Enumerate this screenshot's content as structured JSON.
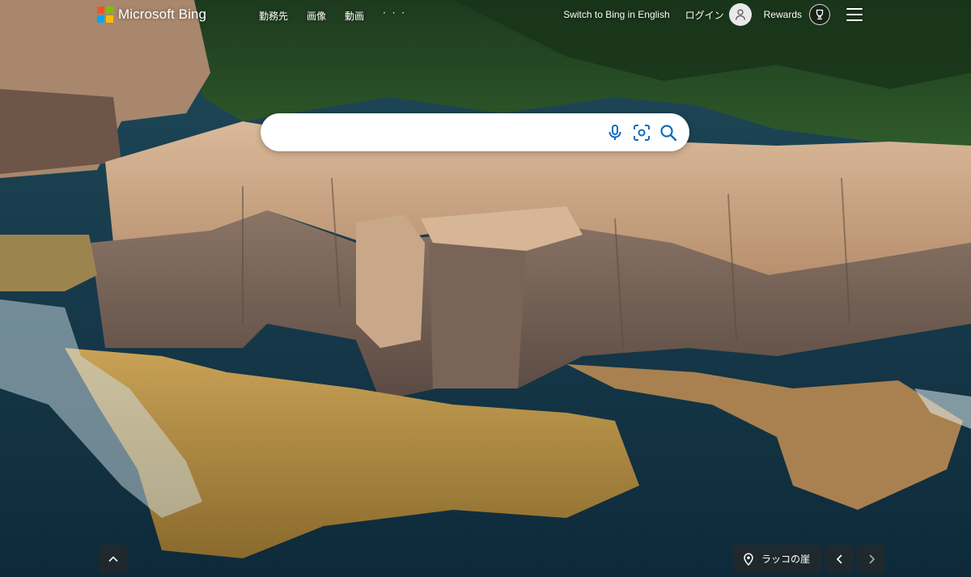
{
  "header": {
    "logo_text": "Microsoft Bing",
    "nav": [
      "勤務先",
      "画像",
      "動画",
      "· · ·"
    ],
    "switch_language": "Switch to Bing in English",
    "login": "ログイン",
    "rewards": "Rewards"
  },
  "search": {
    "value": "",
    "placeholder": ""
  },
  "footer": {
    "location_label": "ラッコの崖"
  },
  "colors": {
    "ms_red": "#f35325",
    "ms_green": "#81bc06",
    "ms_blue": "#05a6f0",
    "ms_yellow": "#ffba08",
    "bing_blue": "#0f6cbd"
  },
  "icons": {
    "mic": "microphone-icon",
    "visual": "visual-search-icon",
    "search": "search-icon",
    "avatar": "user-avatar-icon",
    "rewards": "trophy-icon",
    "menu": "hamburger-icon",
    "scroll": "chevron-up-icon",
    "location": "location-pin-icon",
    "prev": "chevron-left-icon",
    "next": "chevron-right-icon"
  }
}
